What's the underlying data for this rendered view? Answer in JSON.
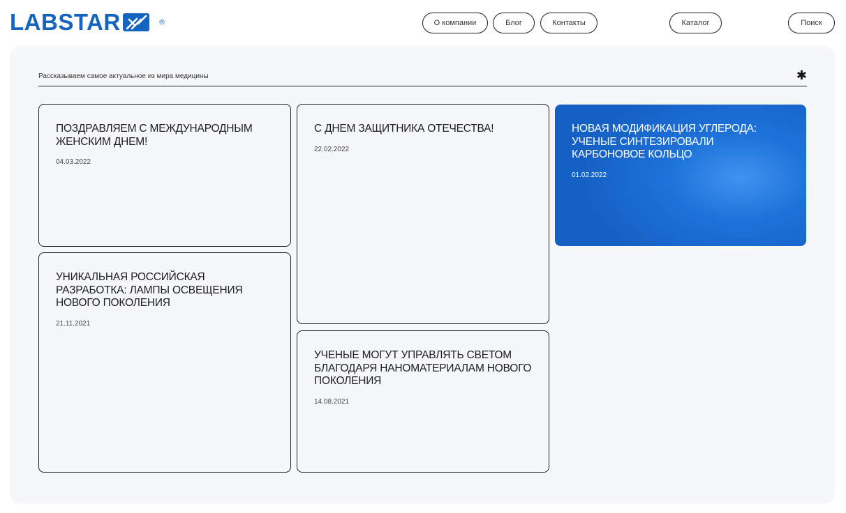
{
  "header": {
    "logo_text": "LABSTAR",
    "logo_reg": "®",
    "nav": {
      "about": "О компании",
      "blog": "Блог",
      "contacts": "Контакты",
      "catalog": "Каталог",
      "search": "Поиск"
    }
  },
  "main": {
    "subtitle": "Рассказываем самое актуальное из мира медицины",
    "asterisk": "✱",
    "articles": [
      {
        "title": "ПОЗДРАВЛЯЕМ С МЕЖДУНАРОДНЫМ ЖЕНСКИМ ДНЕМ!",
        "date": "04.03.2022"
      },
      {
        "title": "С ДНЕМ ЗАЩИТНИКА ОТЕЧЕСТВА!",
        "date": "22.02.2022"
      },
      {
        "title": "НОВАЯ МОДИФИКАЦИЯ УГЛЕРОДА: УЧЕНЫЕ СИНТЕЗИРОВАЛИ КАРБОНОВОЕ КОЛЬЦО",
        "date": "01.02.2022"
      },
      {
        "title": "УНИКАЛЬНАЯ РОССИЙСКАЯ РАЗРАБОТКА: ЛАМПЫ ОСВЕЩЕНИЯ НОВОГО ПОКОЛЕНИЯ",
        "date": "21.11.2021"
      },
      {
        "title": "УЧЕНЫЕ МОГУТ УПРАВЛЯТЬ СВЕТОМ БЛАГОДАРЯ НАНОМАТЕРИАЛАМ НОВОГО ПОКОЛЕНИЯ",
        "date": "14.08.2021"
      }
    ]
  },
  "colors": {
    "brand": "#1565c0",
    "featured_card": "#1d72d9",
    "panel_bg": "#f6f7f9"
  },
  "icons": {
    "logo_mark": "labstar-logo-icon",
    "asterisk": "asterisk-icon"
  }
}
